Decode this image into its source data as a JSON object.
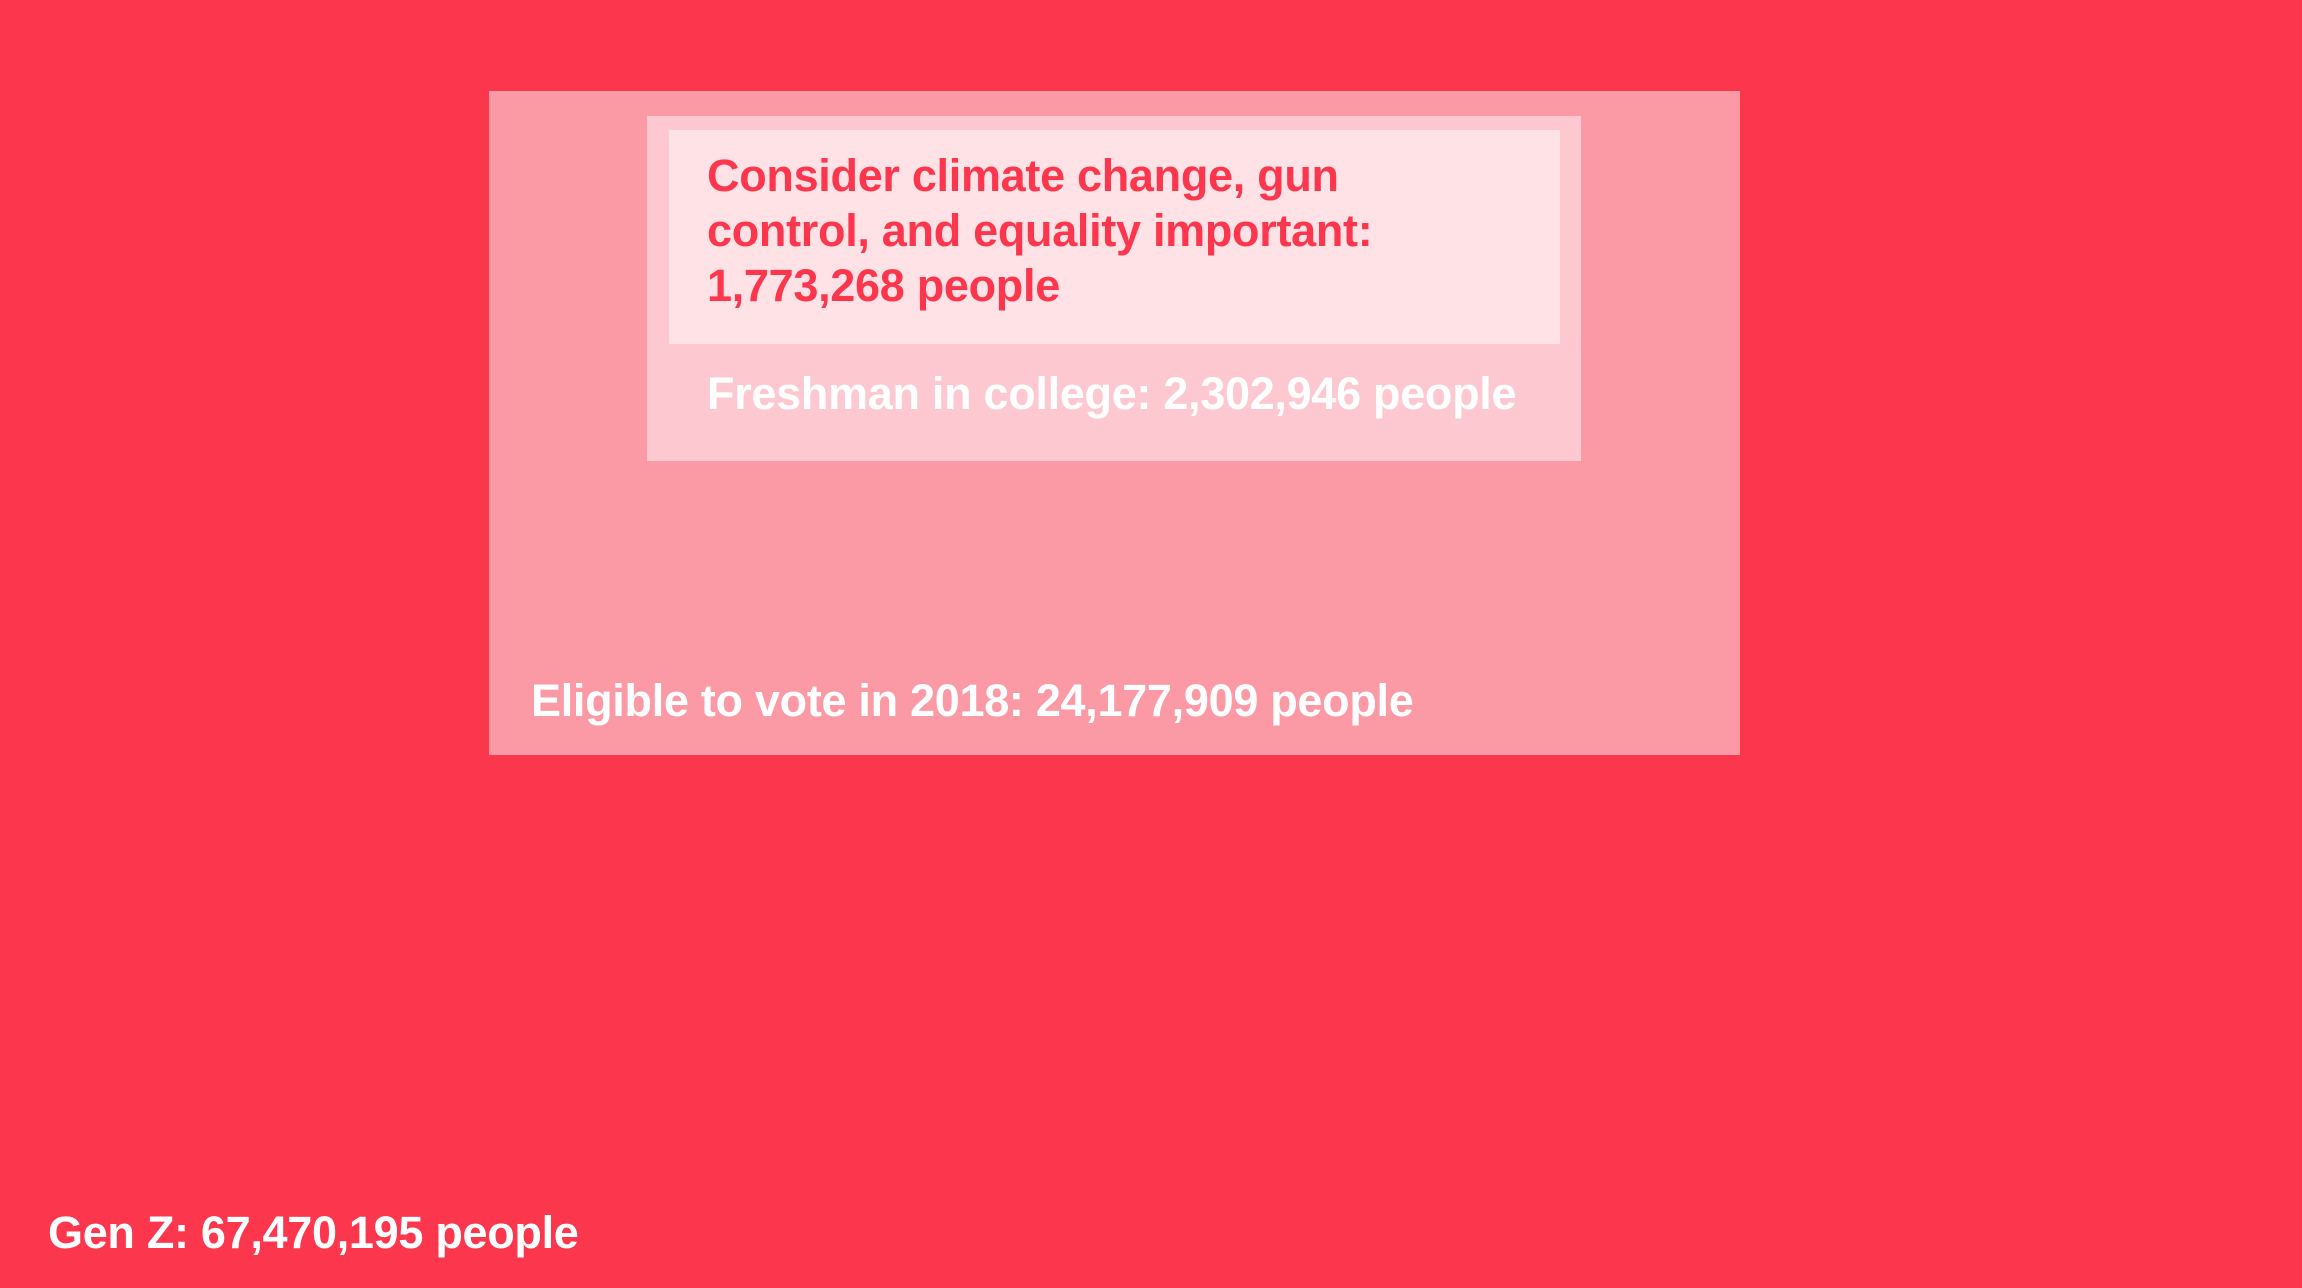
{
  "colors": {
    "background": "#fb364d",
    "eligible_box": "#fb99a5",
    "freshman_box": "#fdc8cf",
    "consider_box": "#fee2e6",
    "light_text": "#ffffff",
    "dark_text": "#fb364d"
  },
  "groups": {
    "gen_z": {
      "label": "Gen Z: 67,470,195 people",
      "count": 67470195
    },
    "eligible": {
      "label": "Eligible to vote in 2018: 24,177,909 people",
      "count": 24177909
    },
    "freshman": {
      "label": "Freshman in college: 2,302,946 people",
      "count": 2302946
    },
    "consider": {
      "label": "Consider climate change, gun control, and equality important: 1,773,268 people",
      "count": 1773268
    }
  }
}
